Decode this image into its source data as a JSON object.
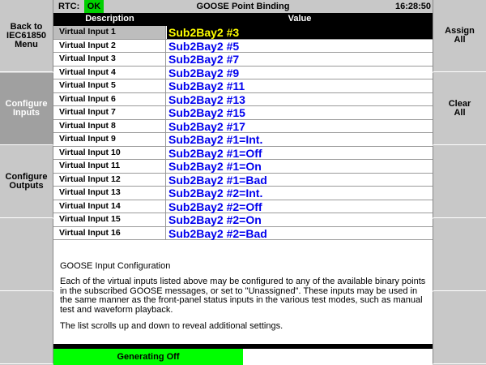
{
  "topbar": {
    "rtc_label": "RTC:",
    "rtc_status": "OK",
    "title": "GOOSE Point Binding",
    "time": "16:28:50"
  },
  "left_buttons": [
    "Back to\nIEC61850\nMenu",
    "Configure\nInputs",
    "Configure\nOutputs",
    "",
    ""
  ],
  "right_buttons": [
    "Assign\nAll",
    "Clear\nAll",
    "",
    "",
    ""
  ],
  "table": {
    "headers": {
      "description": "Description",
      "value": "Value"
    },
    "rows": [
      {
        "description": "Virtual Input 1",
        "value": "Sub2Bay2 #3"
      },
      {
        "description": "Virtual Input 2",
        "value": "Sub2Bay2 #5"
      },
      {
        "description": "Virtual Input 3",
        "value": "Sub2Bay2 #7"
      },
      {
        "description": "Virtual Input 4",
        "value": "Sub2Bay2 #9"
      },
      {
        "description": "Virtual Input 5",
        "value": "Sub2Bay2 #11"
      },
      {
        "description": "Virtual Input 6",
        "value": "Sub2Bay2 #13"
      },
      {
        "description": "Virtual Input 7",
        "value": "Sub2Bay2 #15"
      },
      {
        "description": "Virtual Input 8",
        "value": "Sub2Bay2 #17"
      },
      {
        "description": "Virtual Input 9",
        "value": "Sub2Bay2 #1=Int."
      },
      {
        "description": "Virtual Input 10",
        "value": "Sub2Bay2 #1=Off"
      },
      {
        "description": "Virtual Input 11",
        "value": "Sub2Bay2 #1=On"
      },
      {
        "description": "Virtual Input 12",
        "value": "Sub2Bay2 #1=Bad"
      },
      {
        "description": "Virtual Input 13",
        "value": "Sub2Bay2 #2=Int."
      },
      {
        "description": "Virtual Input 14",
        "value": "Sub2Bay2 #2=Off"
      },
      {
        "description": "Virtual Input 15",
        "value": "Sub2Bay2 #2=On"
      },
      {
        "description": "Virtual Input 16",
        "value": "Sub2Bay2 #2=Bad"
      }
    ]
  },
  "info": {
    "heading": "GOOSE Input Configuration",
    "paragraph1": "Each of the virtual inputs listed above may be configured to any of the available binary points in the subscribed GOOSE messages, or set to \"Unassigned\". These inputs may be used in the same manner as the front-panel status inputs in the various test modes, such as manual test and waveform playback.",
    "paragraph2": "The list scrolls up and down to reveal additional settings."
  },
  "status_bar": {
    "generating": "Generating Off"
  },
  "colors": {
    "ok_green": "#00d000",
    "generating_green": "#00ff00",
    "value_blue": "#0000ee",
    "selected_yellow": "#ffff00",
    "panel_gray": "#c8c8c8"
  }
}
